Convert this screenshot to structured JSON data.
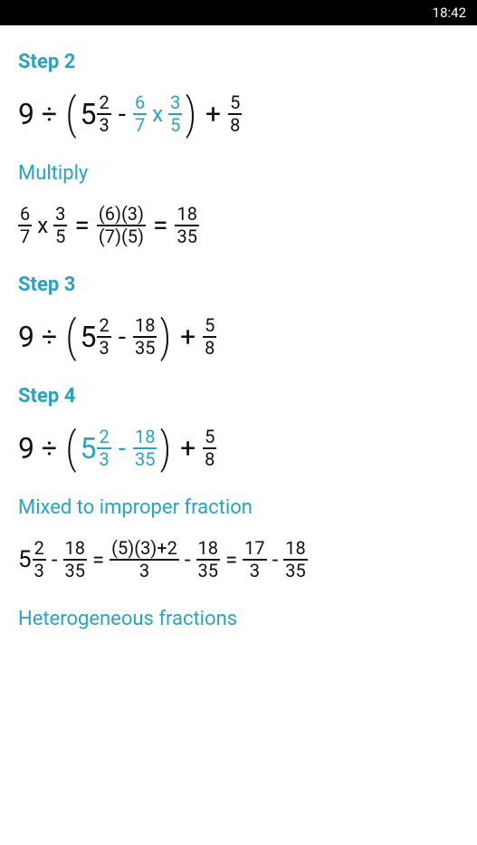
{
  "status": {
    "time": "18:42"
  },
  "steps": {
    "s2": {
      "title": "Step 2",
      "sub": "Multiply"
    },
    "s3": {
      "title": "Step 3"
    },
    "s4": {
      "title": "Step 4",
      "sub1": "Mixed to improper fraction",
      "sub2": "Heterogeneous fractions"
    }
  },
  "v": {
    "nine": "9",
    "div": "÷",
    "mul": "x",
    "plus": "+",
    "minus": "-",
    "eq": "=",
    "lp": "(",
    "rp": ")",
    "five": "5",
    "two": "2",
    "three": "3",
    "six": "6",
    "seven": "7",
    "eight": "8",
    "eighteen": "18",
    "thirtyfive": "35",
    "seventeen": "17",
    "p6": "(6)",
    "p3": "(3)",
    "p7": "(7)",
    "p5": "(5)",
    "mix_num": "(5)(3)+2"
  }
}
